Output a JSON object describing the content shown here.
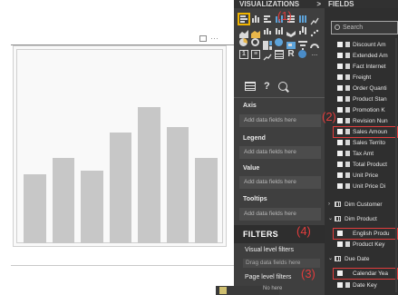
{
  "viz_pane": {
    "title": "VISUALIZATIONS",
    "chevron": ">",
    "wells": [
      {
        "label": "Axis",
        "placeholder": "Add data fields here"
      },
      {
        "label": "Legend",
        "placeholder": "Add data fields here"
      },
      {
        "label": "Value",
        "placeholder": "Add data fields here"
      },
      {
        "label": "Tooltips",
        "placeholder": "Add data fields here"
      }
    ],
    "format_glyph": "?",
    "r_glyph": "R",
    "ellipsis": "...",
    "filters": {
      "title": "FILTERS",
      "visual_level": "Visual level filters",
      "drag_placeholder": "Drag data fields here",
      "page_level": "Page level filters"
    }
  },
  "fields_pane": {
    "title": "FIELDS",
    "search_placeholder": "Search",
    "items": [
      {
        "label": "Discount Am"
      },
      {
        "label": "Extended Am"
      },
      {
        "label": "Fact Internet"
      },
      {
        "label": "Freight"
      },
      {
        "label": "Order Quanti"
      },
      {
        "label": "Product Stan"
      },
      {
        "label": "Promotion K"
      },
      {
        "label": "Revision Nun"
      },
      {
        "label": "Sales Amoun"
      },
      {
        "label": "Sales Territo"
      },
      {
        "label": "Tax Amt"
      },
      {
        "label": "Total Product"
      },
      {
        "label": "Unit Price"
      },
      {
        "label": "Unit Price Di"
      },
      {
        "label": "Dim Customer"
      },
      {
        "label": "Dim Product"
      },
      {
        "label": "English Produ"
      },
      {
        "label": "Product Key"
      },
      {
        "label": "Due Date"
      },
      {
        "label": "Calendar Yea"
      },
      {
        "label": "Date Key"
      }
    ]
  },
  "visual_toolbar": {
    "more": "···"
  },
  "chart_data": {
    "type": "bar",
    "categories": [
      "",
      "",
      "",
      "",
      "",
      "",
      ""
    ],
    "values": [
      38,
      47,
      40,
      61,
      75,
      64,
      47
    ],
    "ylim": [
      0,
      100
    ],
    "xlabel": "",
    "ylabel": "",
    "grid": false
  },
  "annotations": {
    "a1": "(1)",
    "a2": "(2)",
    "a3": "(3)",
    "a4": "(4)"
  },
  "bottom_strip": {
    "text": "No here"
  },
  "colors": {
    "annotation": "#e23d3d",
    "selected": "#f0b400",
    "pane_dark": "#3f3f3f",
    "bar": "#c7c7c7"
  }
}
